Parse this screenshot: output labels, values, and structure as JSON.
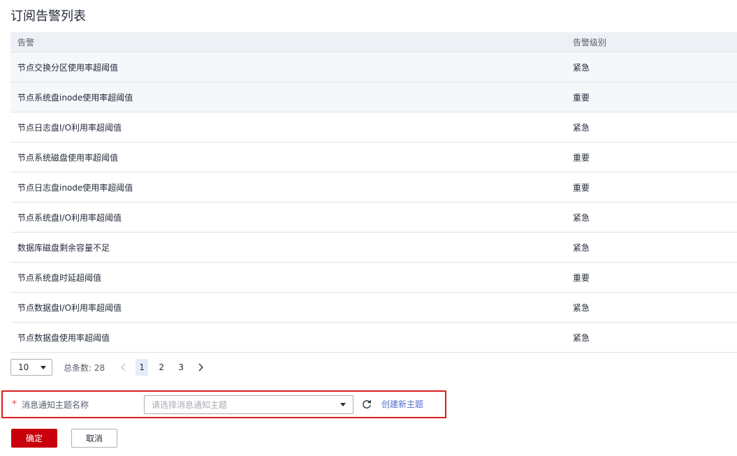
{
  "page": {
    "title": "订阅告警列表"
  },
  "table": {
    "headers": {
      "alarm": "告警",
      "level": "告警级别"
    },
    "rows": [
      {
        "alarm": "节点交换分区使用率超阈值",
        "level": "紧急"
      },
      {
        "alarm": "节点系统盘inode使用率超阈值",
        "level": "重要"
      },
      {
        "alarm": "节点日志盘I/O利用率超阈值",
        "level": "紧急"
      },
      {
        "alarm": "节点系统磁盘使用率超阈值",
        "level": "重要"
      },
      {
        "alarm": "节点日志盘inode使用率超阈值",
        "level": "重要"
      },
      {
        "alarm": "节点系统盘I/O利用率超阈值",
        "level": "紧急"
      },
      {
        "alarm": "数据库磁盘剩余容量不足",
        "level": "紧急"
      },
      {
        "alarm": "节点系统盘时延超阈值",
        "level": "重要"
      },
      {
        "alarm": "节点数据盘I/O利用率超阈值",
        "level": "紧急"
      },
      {
        "alarm": "节点数据盘使用率超阈值",
        "level": "紧急"
      }
    ]
  },
  "pagination": {
    "page_size": "10",
    "total_label": "总条数: 28",
    "pages": [
      "1",
      "2",
      "3"
    ],
    "current_page": "1"
  },
  "form": {
    "required_mark": "*",
    "topic_label": "消息通知主题名称",
    "topic_placeholder": "请选择消息通知主题",
    "create_topic_link": "创建新主题"
  },
  "actions": {
    "confirm_label": "确定",
    "cancel_label": "取消"
  },
  "colors": {
    "primary_button": "#c7000b",
    "highlight_border": "#d81e1e",
    "link": "#526ecc",
    "header_bg": "#eef0f5"
  }
}
